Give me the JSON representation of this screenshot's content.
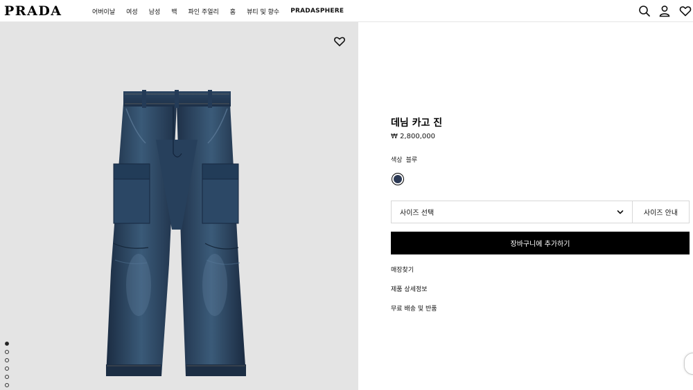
{
  "header": {
    "logo": "PRADA",
    "nav": [
      "어버이날",
      "여성",
      "남성",
      "백",
      "파인 주얼리",
      "홈",
      "뷰티 및 향수",
      "PRADASPHERE"
    ]
  },
  "product": {
    "title": "데님 카고 진",
    "price": "₩ 2,800,000",
    "color_label": "색상",
    "color_value": "블루",
    "swatch_color": "#2c3a55",
    "size_select_label": "사이즈 선택",
    "size_guide_label": "사이즈 안내",
    "add_to_cart_label": "장바구니에 추가하기",
    "links": [
      "매장찾기",
      "제품 상세정보",
      "무료 배송 및 반품"
    ]
  },
  "gallery": {
    "image_count": 6,
    "active_index": 0
  },
  "colors": {
    "accent": "#000000",
    "image_background": "#e4e4e4",
    "denim_dark": "#1d2f45",
    "denim_mid": "#34506d"
  }
}
